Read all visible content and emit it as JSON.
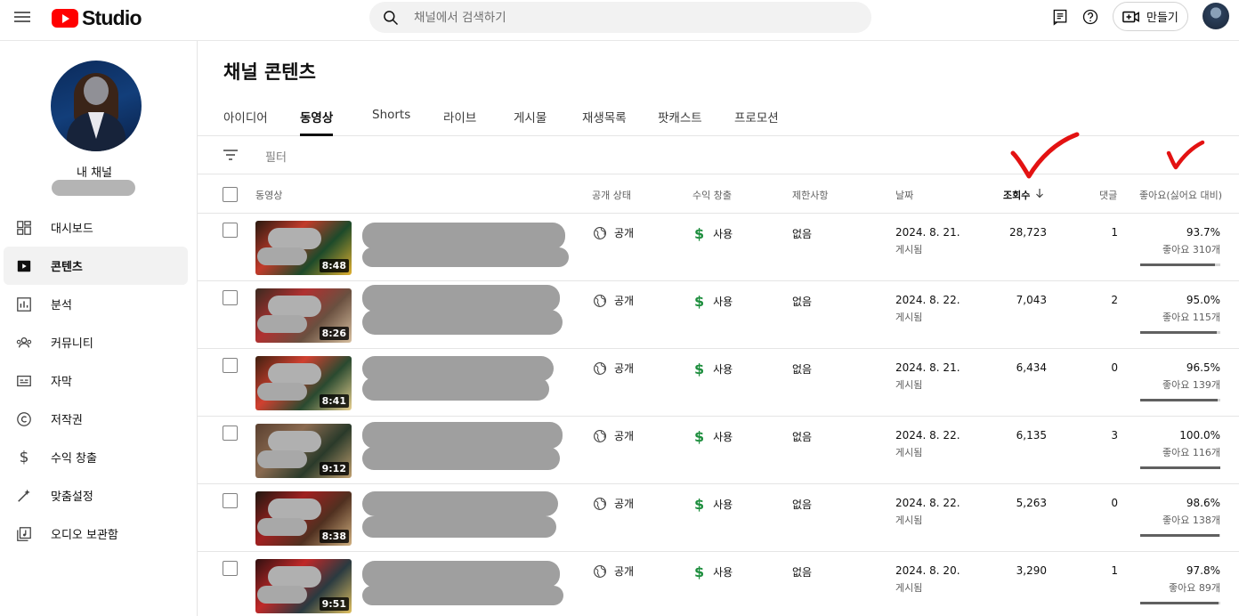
{
  "header": {
    "logo_text": "Studio",
    "search_placeholder": "채널에서 검색하기",
    "create_label": "만들기"
  },
  "sidebar": {
    "channel_name": "내 채널",
    "items": [
      {
        "label": "대시보드",
        "icon": "dashboard-icon"
      },
      {
        "label": "콘텐츠",
        "icon": "content-icon",
        "active": true
      },
      {
        "label": "분석",
        "icon": "analytics-icon"
      },
      {
        "label": "커뮤니티",
        "icon": "community-icon"
      },
      {
        "label": "자막",
        "icon": "subtitles-icon"
      },
      {
        "label": "저작권",
        "icon": "copyright-icon"
      },
      {
        "label": "수익 창출",
        "icon": "earn-icon"
      },
      {
        "label": "맞춤설정",
        "icon": "customization-icon"
      },
      {
        "label": "오디오 보관함",
        "icon": "audio-library-icon"
      }
    ]
  },
  "main": {
    "title": "채널 콘텐츠",
    "tabs": [
      "아이디어",
      "동영상",
      "Shorts",
      "라이브",
      "게시물",
      "재생목록",
      "팟캐스트",
      "프로모션"
    ],
    "active_tab": "동영상",
    "filter_label": "필터"
  },
  "table": {
    "columns": {
      "video": "동영상",
      "visibility": "공개 상태",
      "monetization": "수익 창출",
      "restrictions": "제한사항",
      "date": "날짜",
      "views": "조회수",
      "comments": "댓글",
      "likes": "좋아요(싫어요 대비)"
    },
    "sorted_by": "views",
    "rows": [
      {
        "duration": "8:48",
        "visibility": "공개",
        "monetization": "사용",
        "restrictions": "없음",
        "date": "2024. 8. 21.",
        "date_status": "게시됨",
        "views": "28,723",
        "comments": "1",
        "like_pct": "93.7%",
        "like_count": "좋아요 310개",
        "like_ratio": 0.937
      },
      {
        "duration": "8:26",
        "visibility": "공개",
        "monetization": "사용",
        "restrictions": "없음",
        "date": "2024. 8. 22.",
        "date_status": "게시됨",
        "views": "7,043",
        "comments": "2",
        "like_pct": "95.0%",
        "like_count": "좋아요 115개",
        "like_ratio": 0.95
      },
      {
        "duration": "8:41",
        "visibility": "공개",
        "monetization": "사용",
        "restrictions": "없음",
        "date": "2024. 8. 21.",
        "date_status": "게시됨",
        "views": "6,434",
        "comments": "0",
        "like_pct": "96.5%",
        "like_count": "좋아요 139개",
        "like_ratio": 0.965
      },
      {
        "duration": "9:12",
        "visibility": "공개",
        "monetization": "사용",
        "restrictions": "없음",
        "date": "2024. 8. 22.",
        "date_status": "게시됨",
        "views": "6,135",
        "comments": "3",
        "like_pct": "100.0%",
        "like_count": "좋아요 116개",
        "like_ratio": 1.0
      },
      {
        "duration": "8:38",
        "visibility": "공개",
        "monetization": "사용",
        "restrictions": "없음",
        "date": "2024. 8. 22.",
        "date_status": "게시됨",
        "views": "5,263",
        "comments": "0",
        "like_pct": "98.6%",
        "like_count": "좋아요 138개",
        "like_ratio": 0.986
      },
      {
        "duration": "9:51",
        "visibility": "공개",
        "monetization": "사용",
        "restrictions": "없음",
        "date": "2024. 8. 20.",
        "date_status": "게시됨",
        "views": "3,290",
        "comments": "1",
        "like_pct": "97.8%",
        "like_count": "좋아요 89개",
        "like_ratio": 0.978
      }
    ]
  },
  "colors": {
    "brand": "#ff0000",
    "monetization": "#1e8e3e",
    "annotation_check": "#e31212"
  }
}
